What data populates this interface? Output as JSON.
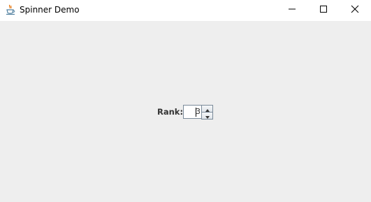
{
  "window": {
    "title": "Spinner Demo",
    "icon": "java-cup-icon",
    "controls": [
      "minimize-icon",
      "maximize-icon",
      "close-icon"
    ]
  },
  "form": {
    "rank_label": "Rank:",
    "rank_value": "3"
  },
  "colors": {
    "background": "#eeeeee",
    "titlebar": "#ffffff",
    "field_border": "#7a8a99"
  }
}
